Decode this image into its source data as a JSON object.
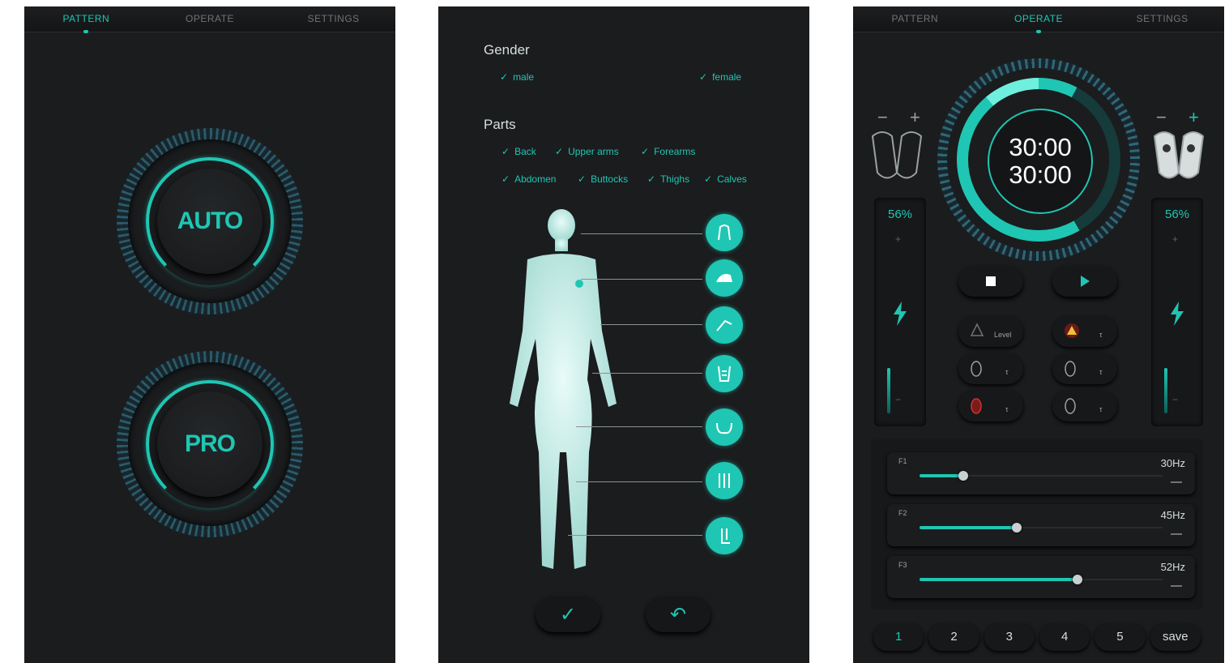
{
  "panel1": {
    "tabs": [
      {
        "label": "PATTERN",
        "active": true
      },
      {
        "label": "OPERATE",
        "active": false
      },
      {
        "label": "SETTINGS",
        "active": false
      }
    ],
    "modes": [
      {
        "label": "AUTO"
      },
      {
        "label": "PRO"
      }
    ]
  },
  "panel2": {
    "gender": {
      "title": "Gender",
      "options": [
        "male",
        "female"
      ]
    },
    "parts": {
      "title": "Parts",
      "row1": [
        "Back",
        "Upper arms",
        "Forearms"
      ],
      "row2": [
        "Abdomen",
        "Buttocks",
        "Thighs",
        "Calves"
      ]
    },
    "actions": {
      "confirm_icon": "check-icon",
      "back_icon": "undo-icon"
    }
  },
  "panel3": {
    "tabs": [
      {
        "label": "PATTERN",
        "active": false
      },
      {
        "label": "OPERATE",
        "active": true
      },
      {
        "label": "SETTINGS",
        "active": false
      }
    ],
    "timer": {
      "time1": "30:00",
      "time2": "30:00"
    },
    "left": {
      "minus": "−",
      "plus": "+",
      "intensity": "56%"
    },
    "right": {
      "minus": "−",
      "plus": "+",
      "intensity": "56%"
    },
    "mode_labels": {
      "level": "Level"
    },
    "frequencies": [
      {
        "label": "F1",
        "value": "30Hz",
        "level": 0.18
      },
      {
        "label": "F2",
        "value": "45Hz",
        "level": 0.4
      },
      {
        "label": "F3",
        "value": "52Hz",
        "level": 0.65
      }
    ],
    "presets": [
      {
        "label": "1",
        "active": true
      },
      {
        "label": "2"
      },
      {
        "label": "3"
      },
      {
        "label": "4"
      },
      {
        "label": "5"
      },
      {
        "label": "save"
      }
    ],
    "accent": "#1fc6b3"
  }
}
